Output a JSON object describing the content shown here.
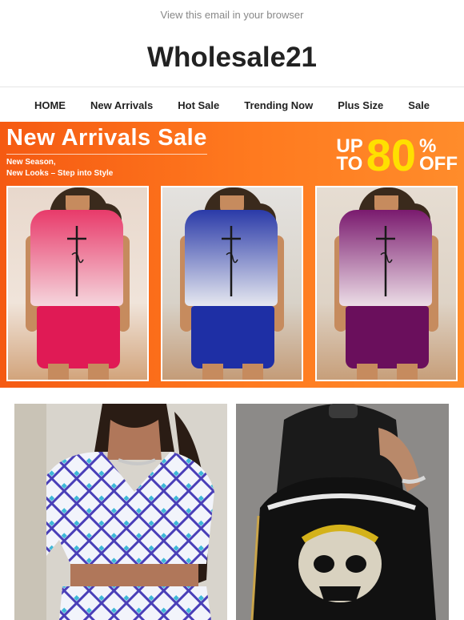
{
  "header": {
    "view_in_browser": "View this email in your browser",
    "logo_text": "Wholesale21"
  },
  "nav": {
    "items": [
      "HOME",
      "New Arrivals",
      "Hot Sale",
      "Trending Now",
      "Plus Size",
      "Sale"
    ]
  },
  "banner": {
    "title": "New Arrivals Sale",
    "subtitle_line1": "New Season,",
    "subtitle_line2": "New Looks – Step into Style",
    "promo_up": "UP",
    "promo_to": "TO",
    "promo_number": "80",
    "promo_percent": "%",
    "promo_off": "OFF",
    "panels": [
      {
        "shirt_top": "#e83a6a",
        "shirt_bottom": "#f5d6dd",
        "shorts": "#e01a55"
      },
      {
        "shirt_top": "#2a3aa8",
        "shirt_bottom": "#e6e8f0",
        "shorts": "#1e2fa5"
      },
      {
        "shirt_top": "#7a1a6e",
        "shirt_bottom": "#ecdde6",
        "shorts": "#6a0f5c"
      }
    ]
  },
  "colors": {
    "banner_orange": "#f55a12",
    "promo_yellow": "#ffe000",
    "nav_text": "#222222",
    "muted_text": "#888888"
  }
}
